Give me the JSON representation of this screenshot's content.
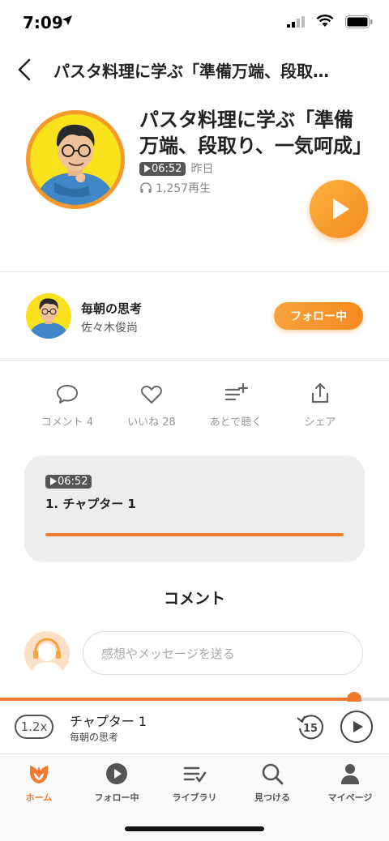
{
  "status": {
    "time": "7:09"
  },
  "nav": {
    "title": "パスタ料理に学ぶ「準備万端、段取…"
  },
  "episode": {
    "title": "パスタ料理に学ぶ「準備万端、段取り、一気呵成」",
    "duration": "06:52",
    "date": "昨日",
    "plays": "1,257再生"
  },
  "channel": {
    "name": "毎朝の思考",
    "author": "佐々木俊尚",
    "follow_label": "フォロー中"
  },
  "actions": [
    {
      "icon": "comment-icon",
      "label": "コメント 4"
    },
    {
      "icon": "heart-icon",
      "label": "いいね 28"
    },
    {
      "icon": "add-queue-icon",
      "label": "あとで聴く"
    },
    {
      "icon": "share-icon",
      "label": "シェア"
    }
  ],
  "chapter": {
    "duration": "06:52",
    "name": "1. チャプター 1"
  },
  "comments": {
    "heading": "コメント",
    "placeholder": "感想やメッセージを送る"
  },
  "player": {
    "speed": "1.2x",
    "title": "チャプター 1",
    "channel": "毎朝の思考",
    "skip_seconds": "15",
    "progress": 0.91
  },
  "tabs": [
    {
      "icon": "home-icon",
      "label": "ホーム",
      "active": true
    },
    {
      "icon": "follow-icon",
      "label": "フォロー中",
      "active": false
    },
    {
      "icon": "library-icon",
      "label": "ライブラリ",
      "active": false
    },
    {
      "icon": "search-icon",
      "label": "見つける",
      "active": false
    },
    {
      "icon": "profile-icon",
      "label": "マイページ",
      "active": false
    }
  ],
  "colors": {
    "accent": "#f07a30",
    "avatar_bg": "#f9e21b"
  }
}
